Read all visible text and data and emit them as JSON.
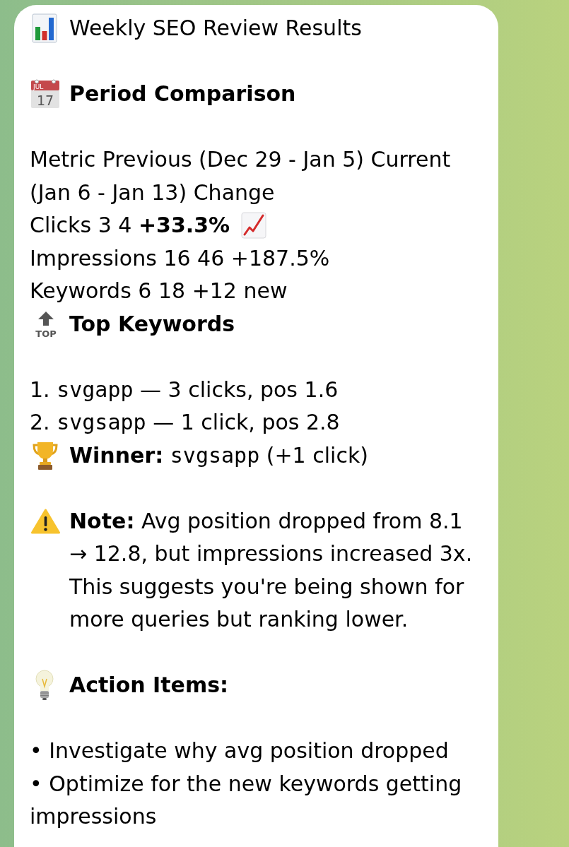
{
  "message": {
    "title": "Weekly SEO Review Results",
    "period_comparison": {
      "icon_month": "JUL",
      "icon_day": "17",
      "heading": "Period Comparison",
      "lines": [
        {
          "kind": "plain",
          "text": "Metric Previous (Dec 29 - Jan 5) Current (Jan 6 - Jan 13) Change"
        },
        {
          "kind": "trend",
          "text": "Clicks 3 4 **+33.3%**"
        },
        {
          "kind": "plain",
          "text": "Impressions 16 46 +187.5%"
        },
        {
          "kind": "plain",
          "text": "Keywords 6 18 +12 new"
        }
      ]
    },
    "top_keywords": {
      "icon_label": "TOP",
      "heading": "Top Keywords",
      "items": [
        {
          "rank": "1.",
          "keyword": "svgapp",
          "detail": "— 3 clicks, pos 1.6"
        },
        {
          "rank": "2.",
          "keyword": "svgsapp",
          "detail": "— 1 click, pos 2.8"
        }
      ]
    },
    "winner": {
      "label": "Winner:",
      "keyword": "svgsapp",
      "detail": "(+1 click)"
    },
    "note": {
      "text": "**Note:** Avg position dropped from 8.1 → 12.8, but impressions increased 3x. This suggests you're being shown for more queries but ranking lower."
    },
    "action_items": {
      "heading": "Action Items:",
      "items": [
        "• Investigate why avg position dropped",
        "• Optimize for the new keywords getting impressions"
      ]
    }
  }
}
